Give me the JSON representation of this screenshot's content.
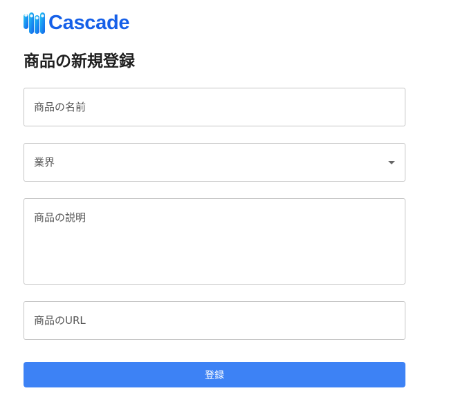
{
  "brand": {
    "name": "Cascade",
    "logo_icon": "cascade-bars-logo-icon",
    "text_color": "#1660e8",
    "mark_colors": [
      "#29c8f0",
      "#1a95f2",
      "#1663e8"
    ]
  },
  "page": {
    "title": "商品の新規登録"
  },
  "form": {
    "product_name": {
      "placeholder": "商品の名前",
      "value": ""
    },
    "industry": {
      "label": "業界",
      "icon": "chevron-down-icon",
      "value": ""
    },
    "description": {
      "placeholder": "商品の説明",
      "value": ""
    },
    "url": {
      "placeholder": "商品のURL",
      "value": ""
    },
    "submit": {
      "label": "登録",
      "color": "#3d82f5"
    }
  }
}
